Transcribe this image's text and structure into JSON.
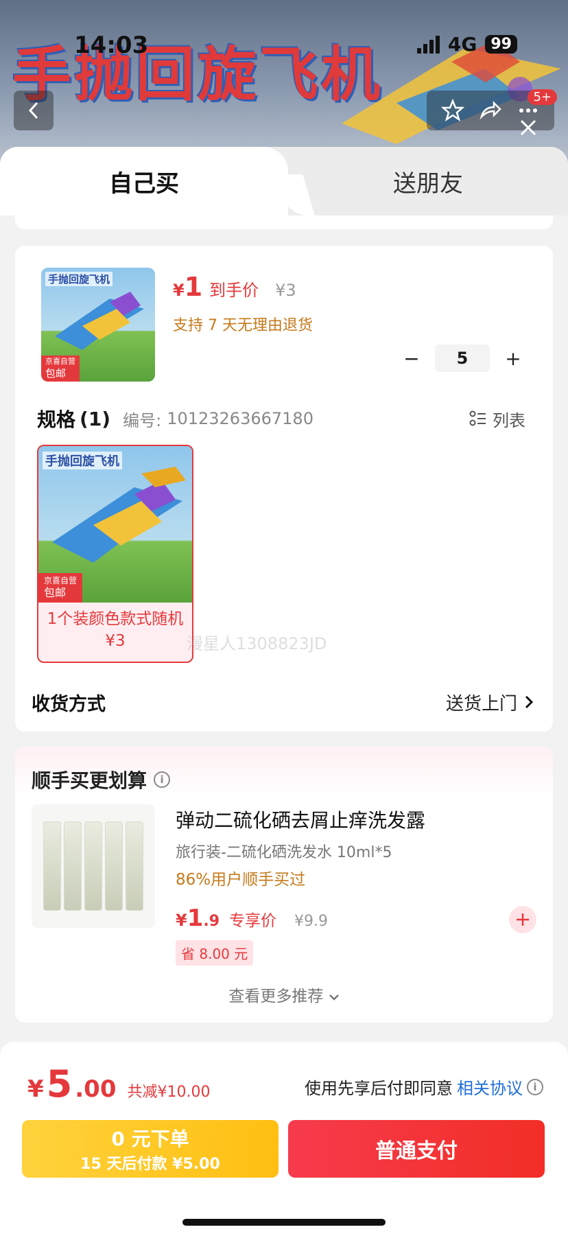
{
  "status_bar": {
    "time": "14:03",
    "network": "4G",
    "battery": "99"
  },
  "hero": {
    "title": "手抛回旋飞机",
    "badge": "5+"
  },
  "tabs": [
    {
      "label": "自己买"
    },
    {
      "label": "送朋友"
    }
  ],
  "product": {
    "thumb_title": "手抛回旋飞机",
    "thumb_label_top": "京喜自营",
    "thumb_label": "包邮",
    "price_symbol": "¥",
    "price": "1",
    "price_tag": "到手价",
    "original_price": "¥3",
    "return_note": "支持 7 天无理由退货",
    "quantity": "5",
    "minus": "−",
    "plus": "+"
  },
  "spec": {
    "title": "规格",
    "count": "(1)",
    "sku_label": "编号:",
    "sku": "10123263667180",
    "list_label": "列表",
    "option_title": "手抛回旋飞机",
    "option_label_top": "京喜自营",
    "option_label": "包邮",
    "option_text": "1个装颜色款式随机 ¥3",
    "watermark": "漫星人1308823JD"
  },
  "shipping": {
    "label": "收货方式",
    "value": "送货上门"
  },
  "upsell": {
    "title": "顺手买更划算",
    "name": "弹动二硫化硒去屑止痒洗发露",
    "subtitle": "旅行装-二硫化硒洗发水 10ml*5",
    "percent": "86%用户顺手买过",
    "price_symbol": "¥",
    "price_int": "1",
    "price_dec": ".9",
    "price_tag": "专享价",
    "original_price": "¥9.9",
    "save": "省 8.00 元",
    "more": "查看更多推荐"
  },
  "footer": {
    "total_symbol": "¥",
    "total_int": "5",
    "total_dec": ".00",
    "saved": "共减¥10.00",
    "agree_text": "使用先享后付即同意",
    "agree_link": "相关协议",
    "pay_later_title": "0 元下单",
    "pay_later_sub": "15 天后付款 ¥5.00",
    "pay_now": "普通支付"
  },
  "colors": {
    "accent_red": "#e4393c",
    "gold": "#ffc21a",
    "link_blue": "#1e6fd9",
    "orange_text": "#c47a1a"
  }
}
